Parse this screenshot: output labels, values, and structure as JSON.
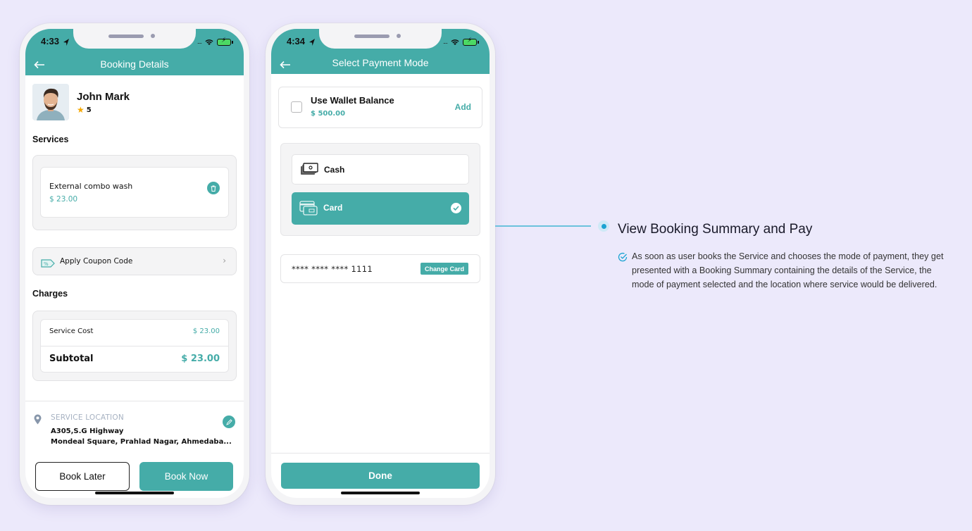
{
  "colors": {
    "background": "#ece9fb",
    "accent": "#45aca8",
    "connector": "#6cc2dc",
    "bullet": "#1aa3d2",
    "star": "#f6a800"
  },
  "booking_screen": {
    "status_time": "4:33",
    "title": "Booking Details",
    "back_icon": "arrow-left-icon",
    "provider": {
      "name": "John Mark",
      "rating": "5"
    },
    "services_label": "Services",
    "services": [
      {
        "name": "External combo wash",
        "price": "$ 23.00"
      }
    ],
    "coupon_label": "Apply Coupon Code",
    "charges_label": "Charges",
    "charges": {
      "service_cost_label": "Service Cost",
      "service_cost_value": "$ 23.00",
      "subtotal_label": "Subtotal",
      "subtotal_value": "$ 23.00"
    },
    "location": {
      "label": "SERVICE LOCATION",
      "line1": "A305,S.G Highway",
      "line2": "Mondeal Square, Prahlad Nagar, Ahmedaba..."
    },
    "book_later_label": "Book Later",
    "book_now_label": "Book Now"
  },
  "payment_screen": {
    "status_time": "4:34",
    "title": "Select Payment Mode",
    "back_icon": "arrow-left-icon",
    "wallet": {
      "title": "Use Wallet Balance",
      "amount": "$ 500.00",
      "add_label": "Add",
      "checked": false
    },
    "payment_options": [
      {
        "label": "Cash",
        "icon": "cash-icon",
        "selected": false
      },
      {
        "label": "Card",
        "icon": "credit-card-icon",
        "selected": true
      }
    ],
    "card_number": "**** **** **** 1111",
    "change_card_label": "Change Card",
    "done_label": "Done"
  },
  "annotation": {
    "title": "View Booking Summary and Pay",
    "description": "As soon as user books the Service and chooses the mode of payment, they get presented with a Booking Summary containing the details of the Service, the mode of payment selected and the location where service would be delivered."
  }
}
